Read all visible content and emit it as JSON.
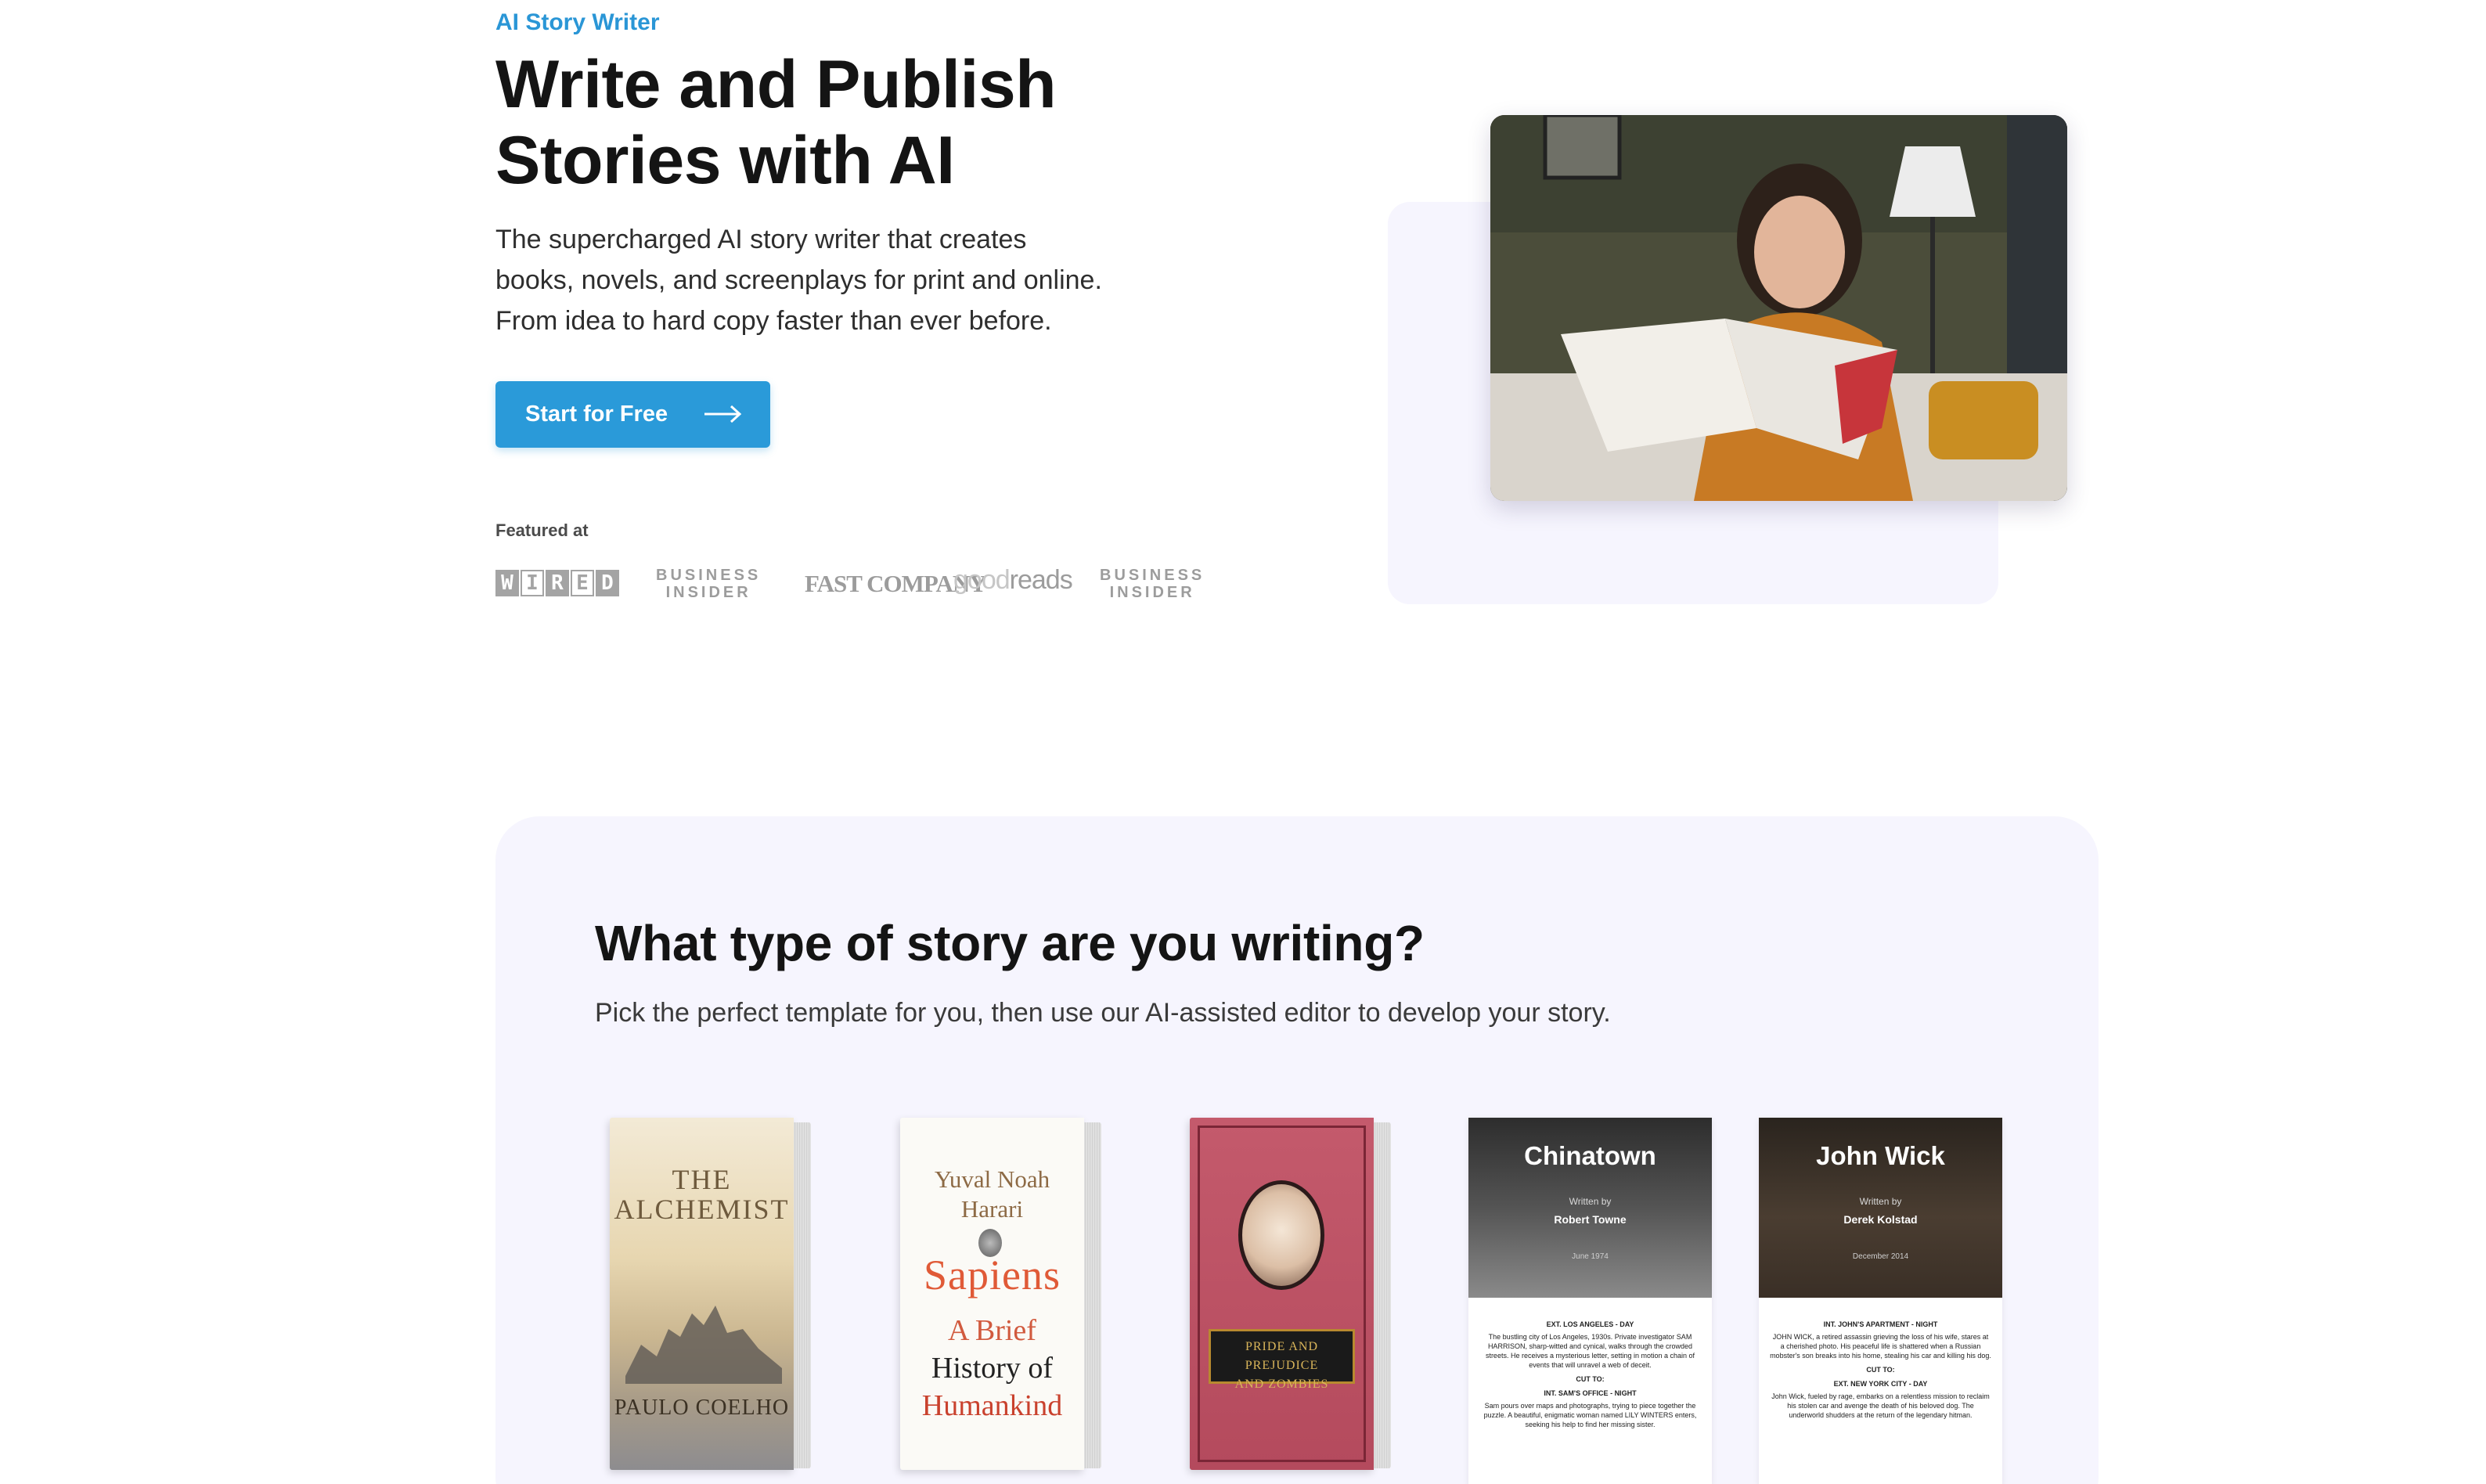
{
  "hero": {
    "eyebrow": "AI Story Writer",
    "title_line1": "Write and Publish",
    "title_line2": "Stories with AI",
    "subtitle_lines": [
      "The supercharged AI story writer that creates",
      "books, novels, and screenplays for print and online.",
      "From idea to hard copy faster than ever before."
    ],
    "cta_label": "Start for Free",
    "cta_icon": "arrow-right-icon",
    "featured_label": "Featured at",
    "logos": {
      "wired": [
        "W",
        "I",
        "R",
        "E",
        "D"
      ],
      "business_insider_1": [
        "BUSINESS",
        "INSIDER"
      ],
      "fast_company": "FAST COMPANY",
      "goodreads_1": "good",
      "goodreads_2": "reads",
      "business_insider_2": [
        "BUSINESS",
        "INSIDER"
      ]
    },
    "accent_color": "#2a9ad9"
  },
  "templates": {
    "title": "What type of story are you writing?",
    "subtitle": "Pick the perfect template for you, then use our AI-assisted editor to develop your story.",
    "books": {
      "alchemist": {
        "title": "THE ALCHEMIST",
        "author": "PAULO COELHO"
      },
      "sapiens": {
        "author_line1": "Yuval Noah",
        "author_line2": "Harari",
        "title": "Sapiens",
        "sub1": "A Brief",
        "sub2": "History of",
        "sub3": "Humankind"
      },
      "pride": {
        "plate_line1": "PRIDE AND PREJUDICE",
        "plate_line2": "AND ZOMBIES"
      }
    },
    "scripts": {
      "chinatown": {
        "title": "Chinatown",
        "written_by": "Written by",
        "author": "Robert Towne",
        "date": "June 1974",
        "scene1": "EXT. LOS ANGELES - DAY",
        "text1": "The bustling city of Los Angeles, 1930s. Private investigator SAM HARRISON, sharp-witted and cynical, walks through the crowded streets. He receives a mysterious letter, setting in motion a chain of events that will unravel a web of deceit.",
        "cut": "CUT TO:",
        "scene2": "INT. SAM'S OFFICE - NIGHT",
        "text2": "Sam pours over maps and photographs, trying to piece together the puzzle. A beautiful, enigmatic woman named LILY WINTERS enters, seeking his help to find her missing sister."
      },
      "john_wick": {
        "title": "John Wick",
        "written_by": "Written by",
        "author": "Derek Kolstad",
        "date": "December 2014",
        "scene1": "INT. JOHN'S APARTMENT - NIGHT",
        "text1": "JOHN WICK, a retired assassin grieving the loss of his wife, stares at a cherished photo. His peaceful life is shattered when a Russian mobster's son breaks into his home, stealing his car and killing his dog.",
        "cut": "CUT TO:",
        "scene2": "EXT. NEW YORK CITY - DAY",
        "text2": "John Wick, fueled by rage, embarks on a relentless mission to reclaim his stolen car and avenge the death of his beloved dog. The underworld shudders at the return of the legendary hitman."
      }
    }
  }
}
